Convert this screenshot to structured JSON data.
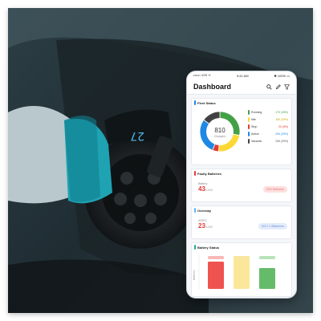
{
  "status_bar": {
    "carrier": "•••••○ iOS ᯤ",
    "time": "9:41 AM",
    "battery": "✱ 100% ▭"
  },
  "header": {
    "title": "Dashboard"
  },
  "fleet": {
    "title": "Fleet Status",
    "total": "810",
    "total_label": "Chargers",
    "legend": [
      {
        "label": "Running",
        "value": "170 (28%)",
        "color": "#43a047",
        "fraction": 0.28
      },
      {
        "label": "Idle",
        "value": "180 (33%)",
        "color": "#fdd835",
        "fraction": 0.23
      },
      {
        "label": "Stop",
        "value": "33 (5%)",
        "color": "#e53935",
        "fraction": 0.05
      },
      {
        "label": "Active",
        "value": "206 (29%)",
        "color": "#1e88e5",
        "fraction": 0.29
      },
      {
        "label": "Vacanta",
        "value": "206 (29%)",
        "color": "#424242",
        "fraction": 0.15
      }
    ]
  },
  "faulty": {
    "title": "Faulty Batteries",
    "label": "Battery",
    "value": "43",
    "total": "/1000",
    "pill": "30% Batteries"
  },
  "overstay": {
    "title": "Overstay",
    "label": "ASPIS",
    "value": "23",
    "total": "/1000",
    "pill": "SOC 1.0Batteries"
  },
  "battery_status": {
    "title": "Battery Status",
    "ylabel": "Batteries",
    "bars": [
      {
        "color": "#ef5350",
        "cap": "#f8b9b8",
        "level": 0.85
      },
      {
        "color": "#fbe79a",
        "cap": "#f8e6a0",
        "level": 0.95
      },
      {
        "color": "#66bb6a",
        "cap": "#b7e4b9",
        "level": 0.65
      }
    ]
  }
}
